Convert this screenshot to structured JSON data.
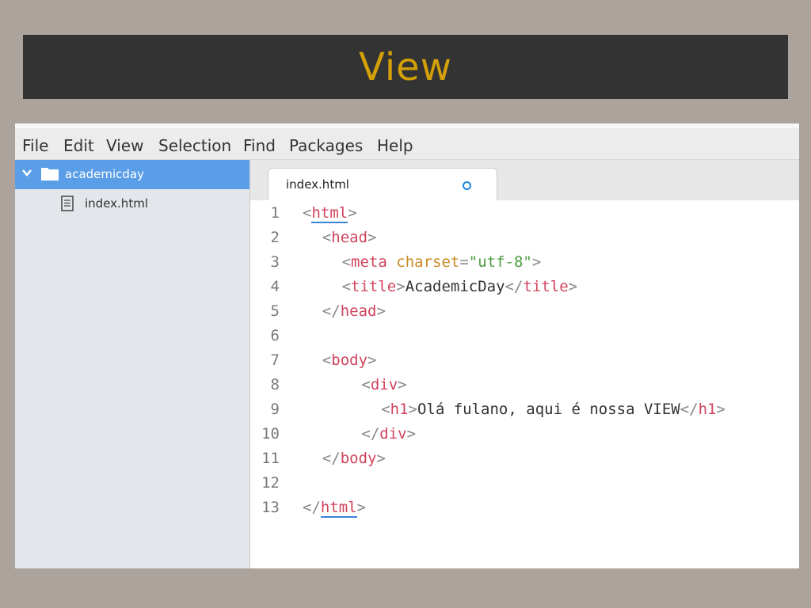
{
  "slide": {
    "title": "View"
  },
  "menu": [
    "File",
    "Edit",
    "View",
    "Selection",
    "Find",
    "Packages",
    "Help"
  ],
  "tree": {
    "root": "academicday",
    "files": [
      "index.html"
    ]
  },
  "tab": {
    "label": "index.html",
    "modified": true
  },
  "editor": {
    "lines": [
      {
        "n": "1",
        "indent": 0,
        "tokens": [
          [
            "p",
            "<"
          ],
          [
            "t",
            "html"
          ],
          [
            "p",
            ">"
          ]
        ]
      },
      {
        "n": "2",
        "indent": 2,
        "tokens": [
          [
            "p",
            "<"
          ],
          [
            "t",
            "head"
          ],
          [
            "p",
            ">"
          ]
        ]
      },
      {
        "n": "3",
        "indent": 4,
        "tokens": [
          [
            "p",
            "<"
          ],
          [
            "t",
            "meta"
          ],
          [
            "txt",
            " "
          ],
          [
            "a",
            "charset"
          ],
          [
            "p",
            "="
          ],
          [
            "s",
            "\"utf-8\""
          ],
          [
            "p",
            ">"
          ]
        ]
      },
      {
        "n": "4",
        "indent": 4,
        "tokens": [
          [
            "p",
            "<"
          ],
          [
            "t",
            "title"
          ],
          [
            "p",
            ">"
          ],
          [
            "txt",
            "AcademicDay"
          ],
          [
            "p",
            "</"
          ],
          [
            "t",
            "title"
          ],
          [
            "p",
            ">"
          ]
        ]
      },
      {
        "n": "5",
        "indent": 2,
        "tokens": [
          [
            "p",
            "</"
          ],
          [
            "t",
            "head"
          ],
          [
            "p",
            ">"
          ]
        ]
      },
      {
        "n": "6",
        "indent": 0,
        "tokens": []
      },
      {
        "n": "7",
        "indent": 2,
        "tokens": [
          [
            "p",
            "<"
          ],
          [
            "t",
            "body"
          ],
          [
            "p",
            ">"
          ]
        ]
      },
      {
        "n": "8",
        "indent": 6,
        "tokens": [
          [
            "p",
            "<"
          ],
          [
            "t",
            "div"
          ],
          [
            "p",
            ">"
          ]
        ]
      },
      {
        "n": "9",
        "indent": 8,
        "tokens": [
          [
            "p",
            "<"
          ],
          [
            "t",
            "h1"
          ],
          [
            "p",
            ">"
          ],
          [
            "txt",
            "Olá fulano, aqui é nossa VIEW"
          ],
          [
            "p",
            "</"
          ],
          [
            "t",
            "h1"
          ],
          [
            "p",
            ">"
          ]
        ]
      },
      {
        "n": "10",
        "indent": 6,
        "tokens": [
          [
            "p",
            "</"
          ],
          [
            "t",
            "div"
          ],
          [
            "p",
            ">"
          ]
        ]
      },
      {
        "n": "11",
        "indent": 2,
        "tokens": [
          [
            "p",
            "</"
          ],
          [
            "t",
            "body"
          ],
          [
            "p",
            ">"
          ]
        ]
      },
      {
        "n": "12",
        "indent": 0,
        "tokens": []
      },
      {
        "n": "13",
        "indent": 0,
        "tokens": [
          [
            "p",
            "</"
          ],
          [
            "t",
            "html"
          ],
          [
            "p",
            ">"
          ]
        ]
      }
    ]
  },
  "colors": {
    "accent_title": "#d4a008",
    "tag": "#d0445d",
    "attribute": "#c98a24",
    "string": "#4a9d3d",
    "selection": "#5b9ee8"
  }
}
